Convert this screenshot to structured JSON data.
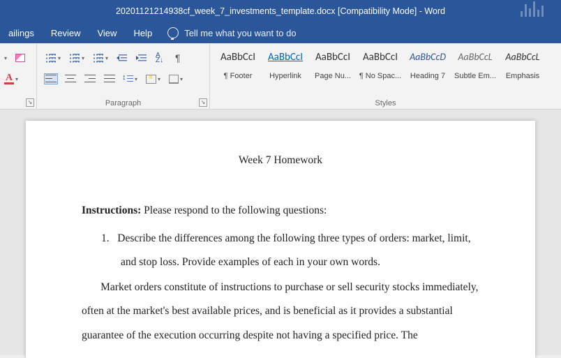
{
  "title": "20201121214938cf_week_7_investments_template.docx [Compatibility Mode]  -  Word",
  "tabs": [
    "ailings",
    "Review",
    "View",
    "Help"
  ],
  "tellme": "Tell me what you want to do",
  "groups": {
    "paragraph_label": "Paragraph",
    "styles_label": "Styles"
  },
  "styles": [
    {
      "preview": "AaBbCcI",
      "label": "¶ Footer",
      "class": ""
    },
    {
      "preview": "AaBbCcI",
      "label": "Hyperlink",
      "class": "link"
    },
    {
      "preview": "AaBbCcI",
      "label": "Page Nu...",
      "class": ""
    },
    {
      "preview": "AaBbCcI",
      "label": "¶ No Spac...",
      "class": ""
    },
    {
      "preview": "AaBbCcD",
      "label": "Heading 7",
      "class": "h7"
    },
    {
      "preview": "AaBbCcL",
      "label": "Subtle Em...",
      "class": "subtle"
    },
    {
      "preview": "AaBbCcL",
      "label": "Emphasis",
      "class": "emph"
    }
  ],
  "doc": {
    "title": "Week 7 Homework",
    "instructions_label": "Instructions:",
    "instructions_text": " Please respond to the following questions:",
    "q_number": "1.",
    "q_text": "Describe the differences among the following three types of orders: market, limit, and stop loss. Provide examples of each in your own words.",
    "body": "Market orders constitute of instructions to purchase or sell security stocks immediately, often at the market's best available prices, and is beneficial as it provides a substantial guarantee of the execution occurring despite not having a specified price. The"
  }
}
